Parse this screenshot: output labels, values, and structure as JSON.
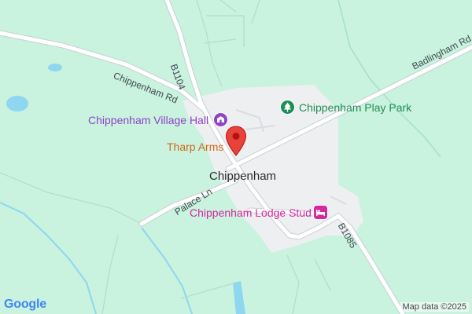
{
  "map": {
    "road_labels": {
      "chippenham_rd": "Chippenham Rd",
      "b1104": "B1104",
      "badlingham_rd": "Badlingham Rd",
      "palace_ln": "Palace Ln",
      "b1085": "B1085"
    },
    "place_label": "Chippenham",
    "pois": {
      "village_hall": "Chippenham Village Hall",
      "play_park": "Chippenham Play Park",
      "tharp_arms": "Tharp Arms",
      "lodge_stud": "Chippenham Lodge Stud"
    },
    "poi_icons": {
      "village_hall": "building-icon",
      "play_park": "tree-icon",
      "lodge_stud": "bed-icon",
      "tharp_arms": "map-pin-icon"
    },
    "attribution": "Map data ©2025",
    "logo_text": "Google",
    "colors": {
      "land": "#c9f2df",
      "urban": "#eeeff1",
      "road": "#ffffff",
      "water": "#8fd6f0",
      "poi_purple": "#8e44c7",
      "poi_green": "#1e8e55",
      "poi_orange": "#cf6a18",
      "poi_pink": "#d52a9f",
      "pin_red": "#e9423b"
    }
  }
}
